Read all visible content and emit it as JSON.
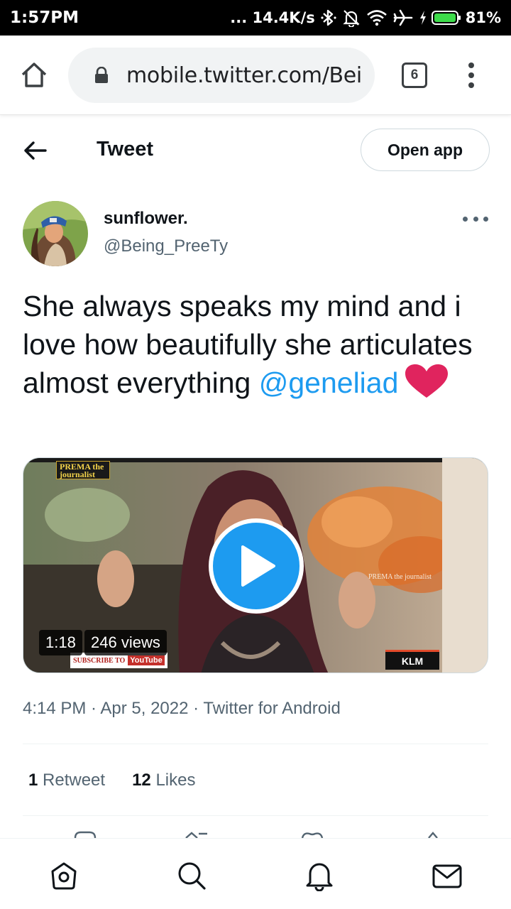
{
  "status_bar": {
    "time": "1:57PM",
    "network_speed": "... 14.4K/s",
    "battery": "81%",
    "icons": [
      "bluetooth-icon",
      "bell-off-icon",
      "wifi-icon",
      "airplane-icon",
      "charging-icon",
      "battery-icon"
    ]
  },
  "browser": {
    "url": "mobile.twitter.com/Bei",
    "tab_count": "6"
  },
  "header": {
    "title": "Tweet",
    "open_app_label": "Open app"
  },
  "tweet": {
    "author_name": "sunflower.",
    "author_handle": "@Being_PreeTy",
    "text": "She always speaks my mind and i love how beautifully she articulates almost everything",
    "mention": "@geneliad",
    "emoji": "heart",
    "video": {
      "duration": "1:18",
      "views": "246 views",
      "watermark_brand": "PREMA the journalist",
      "watermark_caption": "PREMA the journalist",
      "subscribe_text": "SUBSCRIBE TO",
      "subscribe_platform": "YouTube",
      "corner_logo": "KLM"
    },
    "timestamp": "4:14 PM · Apr 5, 2022 · Twitter for Android",
    "retweet_count": "1",
    "retweet_label": "Retweet",
    "likes_count": "12",
    "likes_label": "Likes"
  },
  "bottom_nav": [
    "home-icon",
    "search-icon",
    "notifications-icon",
    "messages-icon"
  ],
  "colors": {
    "accent": "#1d9bf0",
    "heart": "#e0245e",
    "text": "#0f1419",
    "secondary": "#536471"
  }
}
